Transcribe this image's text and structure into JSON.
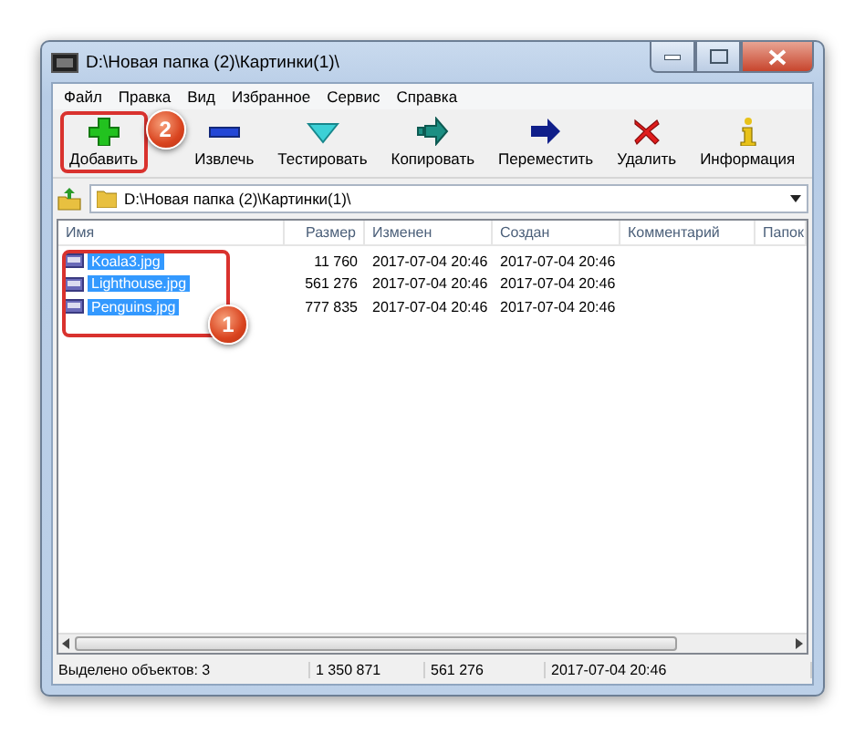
{
  "window": {
    "title": "D:\\Новая папка (2)\\Картинки(1)\\"
  },
  "menu": [
    "Файл",
    "Правка",
    "Вид",
    "Избранное",
    "Сервис",
    "Справка"
  ],
  "toolbar": [
    {
      "kind": "add",
      "label": "Добавить",
      "annotation": {
        "number": "2"
      }
    },
    {
      "kind": "extract",
      "label": "Извлечь"
    },
    {
      "kind": "test",
      "label": "Тестировать"
    },
    {
      "kind": "copy",
      "label": "Копировать"
    },
    {
      "kind": "move",
      "label": "Переместить"
    },
    {
      "kind": "delete",
      "label": "Удалить"
    },
    {
      "kind": "info",
      "label": "Информация"
    }
  ],
  "address": {
    "path": "D:\\Новая папка (2)\\Картинки(1)\\"
  },
  "file_list": {
    "columns": [
      "Имя",
      "Размер",
      "Изменен",
      "Создан",
      "Комментарий",
      "Папок"
    ],
    "annotation": {
      "number": "1"
    },
    "rows": [
      {
        "name": "Koala3.jpg",
        "size": "11 760",
        "modified": "2017-07-04 20:46",
        "created": "2017-07-04 20:46",
        "selected": true
      },
      {
        "name": "Lighthouse.jpg",
        "size": "561 276",
        "modified": "2017-07-04 20:46",
        "created": "2017-07-04 20:46",
        "selected": true
      },
      {
        "name": "Penguins.jpg",
        "size": "777 835",
        "modified": "2017-07-04 20:46",
        "created": "2017-07-04 20:46",
        "selected": true
      }
    ]
  },
  "status_bar": [
    "Выделено объектов: 3",
    "1 350 871",
    "561 276",
    "2017-07-04 20:46"
  ]
}
